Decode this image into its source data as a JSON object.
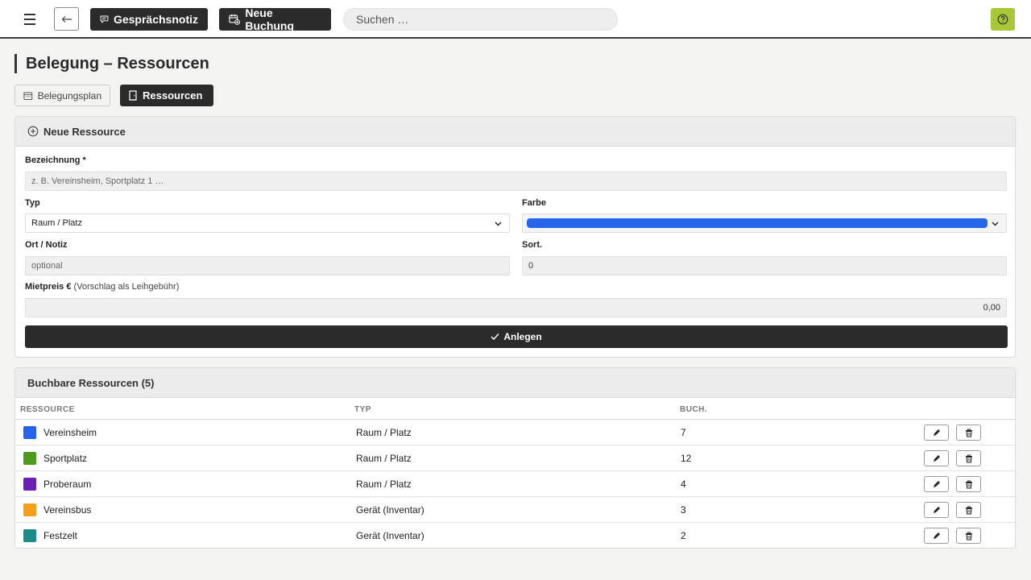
{
  "topbar": {
    "note_button": "Gesprächsnotiz",
    "booking_button": "Neue Buchung",
    "search_placeholder": "Suchen …"
  },
  "page": {
    "title": "Belegung – Ressourcen",
    "tabs": [
      {
        "label": "Belegungsplan",
        "active": false
      },
      {
        "label": "Ressourcen",
        "active": true
      }
    ]
  },
  "form": {
    "title": "Neue Ressource",
    "name_label": "Bezeichnung *",
    "name_placeholder": "z. B. Vereinsheim, Sportplatz 1 …",
    "type_label": "Typ",
    "type_value": "Raum / Platz",
    "color_label": "Farbe",
    "color_value": "#2566ea",
    "location_label": "Ort / Notiz",
    "location_placeholder": "optional",
    "sort_label": "Sort.",
    "sort_value": "0",
    "price_label": "Mietpreis €",
    "price_hint": "(Vorschlag als Leihgebühr)",
    "price_value": "0,00",
    "submit_label": "Anlegen"
  },
  "resources": {
    "title": "Buchbare Ressourcen (5)",
    "columns": [
      "RESSOURCE",
      "TYP",
      "BUCH."
    ],
    "rows": [
      {
        "name": "Vereinsheim",
        "type": "Raum / Platz",
        "bookings": "7",
        "color": "#2563eb"
      },
      {
        "name": "Sportplatz",
        "type": "Raum / Platz",
        "bookings": "12",
        "color": "#4d9a1c"
      },
      {
        "name": "Proberaum",
        "type": "Raum / Platz",
        "bookings": "4",
        "color": "#6a1fb5"
      },
      {
        "name": "Vereinsbus",
        "type": "Gerät (Inventar)",
        "bookings": "3",
        "color": "#f5a01a"
      },
      {
        "name": "Festzelt",
        "type": "Gerät (Inventar)",
        "bookings": "2",
        "color": "#1a8a8a"
      }
    ]
  }
}
